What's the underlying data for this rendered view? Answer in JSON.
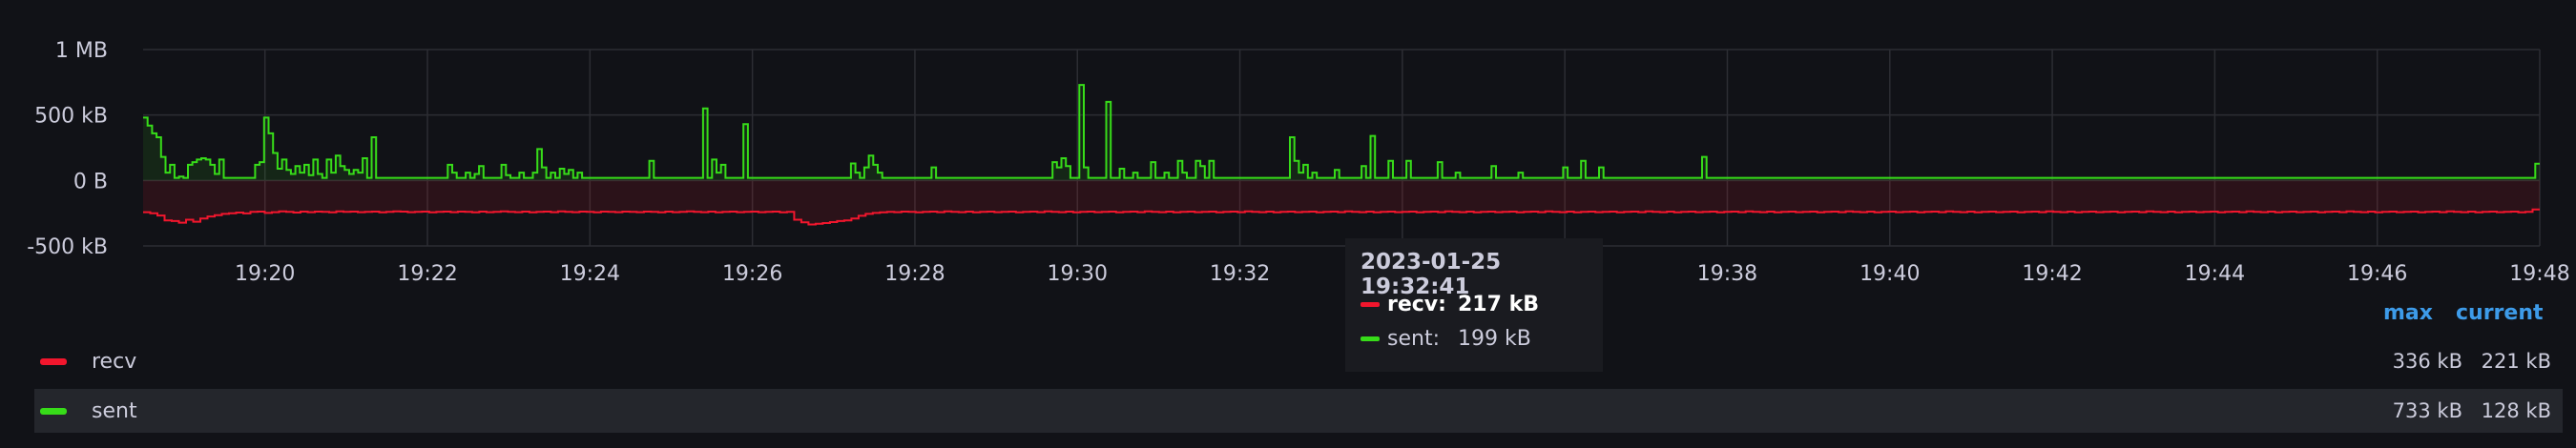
{
  "chart_data": {
    "type": "area",
    "x_start": "19:18:30",
    "x_end": "19:48:00",
    "x_ticks": [
      "19:20",
      "19:22",
      "19:24",
      "19:26",
      "19:28",
      "19:30",
      "19:32",
      "19:34",
      "19:36",
      "19:38",
      "19:40",
      "19:42",
      "19:44",
      "19:46",
      "19:48"
    ],
    "y_ticks": [
      "1 MB",
      "500 kB",
      "0 B",
      "-500 kB"
    ],
    "ylim": [
      -500,
      1000
    ],
    "y_unit": "kB",
    "step_interval_seconds": 10,
    "series": [
      {
        "name": "recv",
        "color": "#f2162d",
        "values": [
          -242,
          -250,
          -268,
          -305,
          -310,
          -322,
          -300,
          -315,
          -290,
          -275,
          -265,
          -255,
          -250,
          -245,
          -252,
          -240,
          -238,
          -248,
          -242,
          -236,
          -240,
          -245,
          -238,
          -242,
          -238,
          -240,
          -244,
          -236,
          -240,
          -238,
          -242,
          -240,
          -238,
          -244,
          -240,
          -236,
          -238,
          -242,
          -240,
          -238,
          -244,
          -240,
          -238,
          -242,
          -238,
          -240,
          -244,
          -238,
          -242,
          -240,
          -236,
          -240,
          -242,
          -238,
          -244,
          -240,
          -238,
          -242,
          -236,
          -240,
          -242,
          -238,
          -240,
          -244,
          -238,
          -240,
          -242,
          -238,
          -240,
          -242,
          -238,
          -240,
          -244,
          -238,
          -242,
          -240,
          -236,
          -240,
          -242,
          -238,
          -244,
          -240,
          -238,
          -242,
          -240,
          -238,
          -242,
          -240,
          -238,
          -244,
          -240,
          -300,
          -320,
          -336,
          -330,
          -325,
          -318,
          -310,
          -305,
          -290,
          -270,
          -255,
          -248,
          -244,
          -240,
          -242,
          -238,
          -240,
          -244,
          -240,
          -238,
          -242,
          -236,
          -240,
          -242,
          -238,
          -244,
          -240,
          -238,
          -242,
          -240,
          -238,
          -244,
          -240,
          -238,
          -242,
          -236,
          -240,
          -242,
          -238,
          -244,
          -240,
          -238,
          -242,
          -240,
          -238,
          -244,
          -240,
          -238,
          -242,
          -236,
          -240,
          -242,
          -238,
          -244,
          -240,
          -238,
          -242,
          -240,
          -238,
          -244,
          -240,
          -238,
          -242,
          -236,
          -240,
          -242,
          -238,
          -244,
          -240,
          -238,
          -242,
          -240,
          -238,
          -244,
          -240,
          -238,
          -242,
          -236,
          -240,
          -242,
          -238,
          -244,
          -240,
          -238,
          -242,
          -240,
          -238,
          -244,
          -240,
          -238,
          -242,
          -236,
          -240,
          -242,
          -238,
          -244,
          -240,
          -238,
          -242,
          -240,
          -238,
          -244,
          -240,
          -238,
          -242,
          -236,
          -240,
          -242,
          -238,
          -244,
          -240,
          -238,
          -242,
          -240,
          -238,
          -244,
          -240,
          -238,
          -242,
          -236,
          -240,
          -242,
          -238,
          -244,
          -240,
          -238,
          -242,
          -240,
          -238,
          -244,
          -240,
          -238,
          -242,
          -236,
          -240,
          -242,
          -238,
          -244,
          -240,
          -238,
          -242,
          -240,
          -238,
          -244,
          -240,
          -238,
          -242,
          -236,
          -240,
          -242,
          -238,
          -244,
          -240,
          -238,
          -242,
          -240,
          -238,
          -244,
          -240,
          -238,
          -242,
          -236,
          -240,
          -242,
          -238,
          -244,
          -240,
          -238,
          -242,
          -240,
          -238,
          -244,
          -240,
          -238,
          -242,
          -236,
          -240,
          -242,
          -238,
          -244,
          -240,
          -238,
          -242,
          -240,
          -238,
          -244,
          -240,
          -238,
          -242,
          -236,
          -240,
          -242,
          -238,
          -244,
          -240,
          -238,
          -242,
          -240,
          -238,
          -244,
          -240,
          -238,
          -242,
          -236,
          -240,
          -242,
          -238,
          -244,
          -240,
          -238,
          -242,
          -240,
          -238,
          -244,
          -240,
          -238,
          -242,
          -236,
          -240,
          -242,
          -238,
          -244,
          -240,
          -238,
          -242,
          -240,
          -238,
          -244,
          -240,
          -238,
          -242,
          -236,
          -240,
          -242,
          -238,
          -244,
          -240,
          -238,
          -242,
          -240,
          -238,
          -244,
          -240,
          -221
        ]
      },
      {
        "name": "sent",
        "color": "#73bf69",
        "line_color": "#37dc19",
        "values": [
          480,
          420,
          360,
          330,
          180,
          60,
          120,
          20,
          30,
          20,
          120,
          140,
          160,
          170,
          160,
          120,
          50,
          160,
          20,
          20,
          20,
          20,
          20,
          20,
          20,
          120,
          140,
          480,
          360,
          210,
          90,
          160,
          80,
          50,
          110,
          60,
          120,
          40,
          160,
          50,
          20,
          160,
          60,
          190,
          110,
          80,
          50,
          80,
          60,
          170,
          20,
          330,
          20,
          20,
          20,
          20,
          20,
          20,
          20,
          20,
          20,
          20,
          20,
          20,
          20,
          20,
          20,
          20,
          120,
          60,
          20,
          20,
          60,
          20,
          50,
          110,
          20,
          20,
          20,
          20,
          120,
          40,
          20,
          20,
          60,
          20,
          20,
          60,
          240,
          100,
          20,
          60,
          20,
          90,
          50,
          80,
          20,
          60,
          20,
          20,
          20,
          20,
          20,
          20,
          20,
          20,
          20,
          20,
          20,
          20,
          20,
          20,
          20,
          150,
          20,
          20,
          20,
          20,
          20,
          20,
          20,
          20,
          20,
          20,
          20,
          550,
          20,
          160,
          60,
          120,
          20,
          20,
          20,
          20,
          430,
          20,
          20,
          20,
          20,
          20,
          20,
          20,
          20,
          20,
          20,
          20,
          20,
          20,
          20,
          20,
          20,
          20,
          20,
          20,
          20,
          20,
          20,
          20,
          130,
          60,
          20,
          100,
          190,
          120,
          60,
          20,
          20,
          20,
          20,
          20,
          20,
          20,
          20,
          20,
          20,
          20,
          100,
          20,
          20,
          20,
          20,
          20,
          20,
          20,
          20,
          20,
          20,
          20,
          20,
          20,
          20,
          20,
          20,
          20,
          20,
          20,
          20,
          20,
          20,
          20,
          20,
          20,
          20,
          140,
          100,
          170,
          110,
          20,
          20,
          730,
          100,
          20,
          20,
          20,
          20,
          600,
          20,
          20,
          90,
          20,
          20,
          60,
          20,
          20,
          20,
          140,
          20,
          20,
          60,
          20,
          20,
          150,
          60,
          20,
          20,
          150,
          110,
          20,
          150,
          20,
          20,
          20,
          20,
          20,
          20,
          20,
          20,
          20,
          20,
          20,
          20,
          20,
          20,
          20,
          20,
          20,
          330,
          150,
          60,
          120,
          20,
          60,
          20,
          20,
          20,
          20,
          80,
          20,
          20,
          20,
          20,
          20,
          110,
          20,
          340,
          20,
          20,
          20,
          150,
          20,
          20,
          20,
          150,
          20,
          20,
          20,
          20,
          20,
          20,
          140,
          20,
          20,
          20,
          60,
          20,
          20,
          20,
          20,
          20,
          20,
          20,
          110,
          20,
          20,
          20,
          20,
          20,
          60,
          20,
          20,
          20,
          20,
          20,
          20,
          20,
          20,
          20,
          100,
          20,
          20,
          20,
          150,
          20,
          20,
          20,
          100,
          20,
          20,
          20,
          20,
          20,
          20,
          20,
          20,
          20,
          20,
          20,
          20,
          20,
          20,
          20,
          20,
          20,
          20,
          20,
          20,
          20,
          20,
          180,
          20,
          20,
          20,
          20,
          20,
          20,
          20,
          20,
          20,
          20,
          20,
          20,
          20,
          20,
          20,
          20,
          20,
          20,
          20,
          20,
          20,
          20,
          20,
          20,
          20,
          20,
          20,
          20,
          20,
          20,
          20,
          20,
          20,
          20,
          20,
          20,
          20,
          20,
          20,
          20,
          20,
          20,
          20,
          20,
          20,
          20,
          20,
          20,
          20,
          20,
          20,
          20,
          20,
          20,
          20,
          20,
          20,
          20,
          20,
          20,
          20,
          20,
          20,
          20,
          20,
          20,
          20,
          20,
          20,
          20,
          20,
          20,
          20,
          20,
          20,
          20,
          20,
          20,
          20,
          20,
          20,
          20,
          20,
          20,
          20,
          20,
          20,
          20,
          20,
          20,
          20,
          20,
          20,
          20,
          20,
          20,
          20,
          20,
          20,
          20,
          20,
          20,
          20,
          20,
          20,
          20,
          20,
          20,
          20,
          20,
          20,
          20,
          20,
          20,
          20,
          20,
          20,
          20,
          20,
          20,
          20,
          20,
          20,
          20,
          20,
          20,
          20,
          20,
          20,
          20,
          20,
          20,
          20,
          20,
          20,
          20,
          20,
          20,
          20,
          20,
          20,
          20,
          20,
          20,
          20,
          20,
          20,
          20,
          20,
          20,
          20,
          20,
          20,
          20,
          20,
          20,
          20,
          20,
          20,
          20,
          20,
          20,
          20,
          20,
          20,
          20,
          20,
          20,
          20,
          20,
          20,
          20,
          20,
          20,
          20,
          20,
          20,
          20,
          20,
          20,
          20,
          20,
          20,
          20,
          20,
          128
        ]
      }
    ],
    "grid": true,
    "legend": "bottom"
  },
  "legend": {
    "headers": {
      "max": "max",
      "current": "current"
    },
    "rows": [
      {
        "name": "recv",
        "color": "#f2162d",
        "max": "336 kB",
        "current": "221 kB"
      },
      {
        "name": "sent",
        "color": "#37dc19",
        "max": "733 kB",
        "current": "128 kB"
      }
    ]
  },
  "tooltip": {
    "time": "2023-01-25 19:32:41",
    "rows": [
      {
        "name": "recv:",
        "color": "#f2162d",
        "value": "217 kB"
      },
      {
        "name": "sent:",
        "color": "#37dc19",
        "value": "199 kB"
      }
    ]
  }
}
